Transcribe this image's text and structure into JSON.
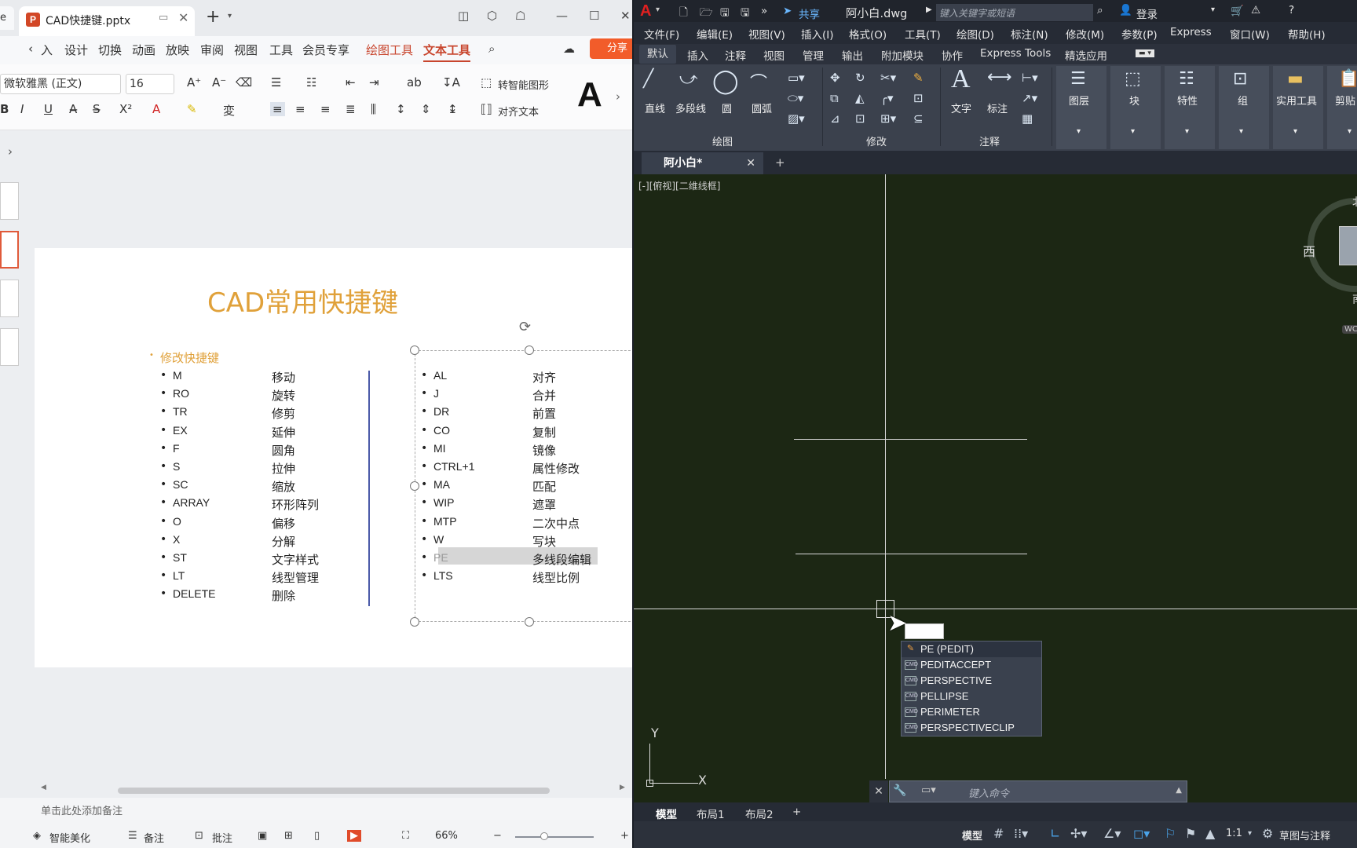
{
  "wps": {
    "prev_tab_label": "e",
    "tab_title": "CAD快捷键.pptx",
    "menu": [
      "入",
      "设计",
      "切换",
      "动画",
      "放映",
      "审阅",
      "视图",
      "工具",
      "会员专享",
      "绘图工具",
      "文本工具"
    ],
    "share_label": "分享",
    "font_name": "微软雅黑 (正文)",
    "font_size": "16",
    "smart_graphic": "转智能图形",
    "align_text": "对齐文本",
    "big_letter": "A",
    "slide": {
      "title": "CAD常用快捷键",
      "section_heading": "修改快捷键",
      "left_items": [
        {
          "key": "M",
          "desc": "移动"
        },
        {
          "key": "RO",
          "desc": "旋转"
        },
        {
          "key": "TR",
          "desc": "修剪"
        },
        {
          "key": "EX",
          "desc": "延伸"
        },
        {
          "key": "F",
          "desc": "圆角"
        },
        {
          "key": "S",
          "desc": "拉伸"
        },
        {
          "key": "SC",
          "desc": "缩放"
        },
        {
          "key": "ARRAY",
          "desc": "环形阵列"
        },
        {
          "key": "O",
          "desc": "偏移"
        },
        {
          "key": "X",
          "desc": "分解"
        },
        {
          "key": "ST",
          "desc": "文字样式"
        },
        {
          "key": "LT",
          "desc": "线型管理"
        },
        {
          "key": "DELETE",
          "desc": "删除"
        }
      ],
      "right_items": [
        {
          "key": "AL",
          "desc": "对齐"
        },
        {
          "key": "J",
          "desc": "合并"
        },
        {
          "key": "DR",
          "desc": "前置"
        },
        {
          "key": "CO",
          "desc": "复制"
        },
        {
          "key": "MI",
          "desc": "镜像"
        },
        {
          "key": "CTRL+1",
          "desc": "属性修改"
        },
        {
          "key": "MA",
          "desc": "匹配"
        },
        {
          "key": "WIP",
          "desc": "遮罩"
        },
        {
          "key": "MTP",
          "desc": "二次中点"
        },
        {
          "key": "W",
          "desc": "写块"
        },
        {
          "key": "PE",
          "desc": "多线段编辑"
        },
        {
          "key": "LTS",
          "desc": "线型比例"
        }
      ]
    },
    "notes_placeholder": "单击此处添加备注",
    "status": {
      "beautify": "智能美化",
      "notes": "备注",
      "comment": "批注",
      "zoom": "66%"
    }
  },
  "cad": {
    "share": "共享",
    "file_title": "阿小白.dwg",
    "search_placeholder": "键入关键字或短语",
    "login": "登录",
    "menu": [
      "文件(F)",
      "编辑(E)",
      "视图(V)",
      "插入(I)",
      "格式(O)",
      "工具(T)",
      "绘图(D)",
      "标注(N)",
      "修改(M)",
      "参数(P)",
      "Express",
      "窗口(W)",
      "帮助(H)"
    ],
    "ribbon_tabs": [
      "默认",
      "插入",
      "注释",
      "视图",
      "管理",
      "输出",
      "附加模块",
      "协作",
      "Express Tools",
      "精选应用"
    ],
    "ribbon": {
      "line": "直线",
      "polyline": "多段线",
      "circle": "圆",
      "arc": "圆弧",
      "text": "文字",
      "dimension": "标注",
      "layers": "图层",
      "block": "块",
      "properties": "特性",
      "group": "组",
      "utilities": "实用工具",
      "clipboard": "剪贴",
      "group_draw": "绘图",
      "group_modify": "修改",
      "group_annotate": "注释"
    },
    "doc_tab": "阿小白*",
    "viewport_label": "[-][俯视][二维线框]",
    "viewcube_west": "西",
    "viewcube_north": "北",
    "viewcube_south": "南",
    "wcs": "WCS",
    "ucs_x": "X",
    "ucs_y": "Y",
    "autocomplete": [
      "PE (PEDIT)",
      "PEDITACCEPT",
      "PERSPECTIVE",
      "PELLIPSE",
      "PERIMETER",
      "PERSPECTIVECLIP"
    ],
    "command_placeholder": "键入命令",
    "layout_tabs": [
      "模型",
      "布局1",
      "布局2"
    ],
    "status": {
      "model": "模型",
      "scale": "1:1",
      "workspace": "草图与注释"
    }
  }
}
